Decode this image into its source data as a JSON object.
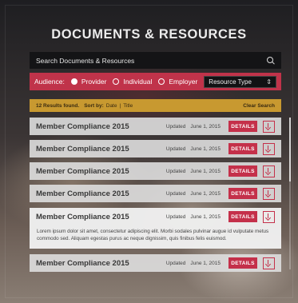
{
  "page": {
    "title": "DOCUMENTS & RESOURCES"
  },
  "search": {
    "placeholder": "Search Documents & Resources",
    "icon": "search-icon"
  },
  "audience": {
    "label": "Audience:",
    "options": [
      {
        "label": "Provider",
        "selected": true
      },
      {
        "label": "Individual",
        "selected": false
      },
      {
        "label": "Employer",
        "selected": false
      }
    ],
    "resource_type": "Resource Type"
  },
  "results_bar": {
    "count_text": "12 Results found.",
    "sort_label": "Sort by:",
    "sort_date": "Date",
    "sort_sep": "|",
    "sort_title": "Title",
    "clear": "Clear Search"
  },
  "documents": [
    {
      "name": "Member Compliance 2015",
      "updated_label": "Updated",
      "date": "June 1, 2015",
      "details": "DETAILS"
    },
    {
      "name": "Member Compliance 2015",
      "updated_label": "Updated",
      "date": "June 1, 2015",
      "details": "DETAILS"
    },
    {
      "name": "Member Compliance 2015",
      "updated_label": "Updated",
      "date": "June 1, 2015",
      "details": "DETAILS"
    },
    {
      "name": "Member Compliance 2015",
      "updated_label": "Updated",
      "date": "June 1, 2015",
      "details": "DETAILS"
    },
    {
      "name": "Member Compliance 2015",
      "updated_label": "Updated",
      "date": "June 1, 2015",
      "details": "DETAILS",
      "description": "Lorem ipsum dolor sit amet, consectetur adipiscing elit. Morbi sodales pulvinar augue id vulputate metus commodo sed. Aliquam egestas purus ac neque dignissim, quis finibus felis euismod."
    },
    {
      "name": "Member Compliance 2015",
      "updated_label": "Updated",
      "date": "June 1, 2015",
      "details": "DETAILS"
    }
  ],
  "colors": {
    "accent": "#c0334a",
    "results_bar": "#c89930"
  }
}
